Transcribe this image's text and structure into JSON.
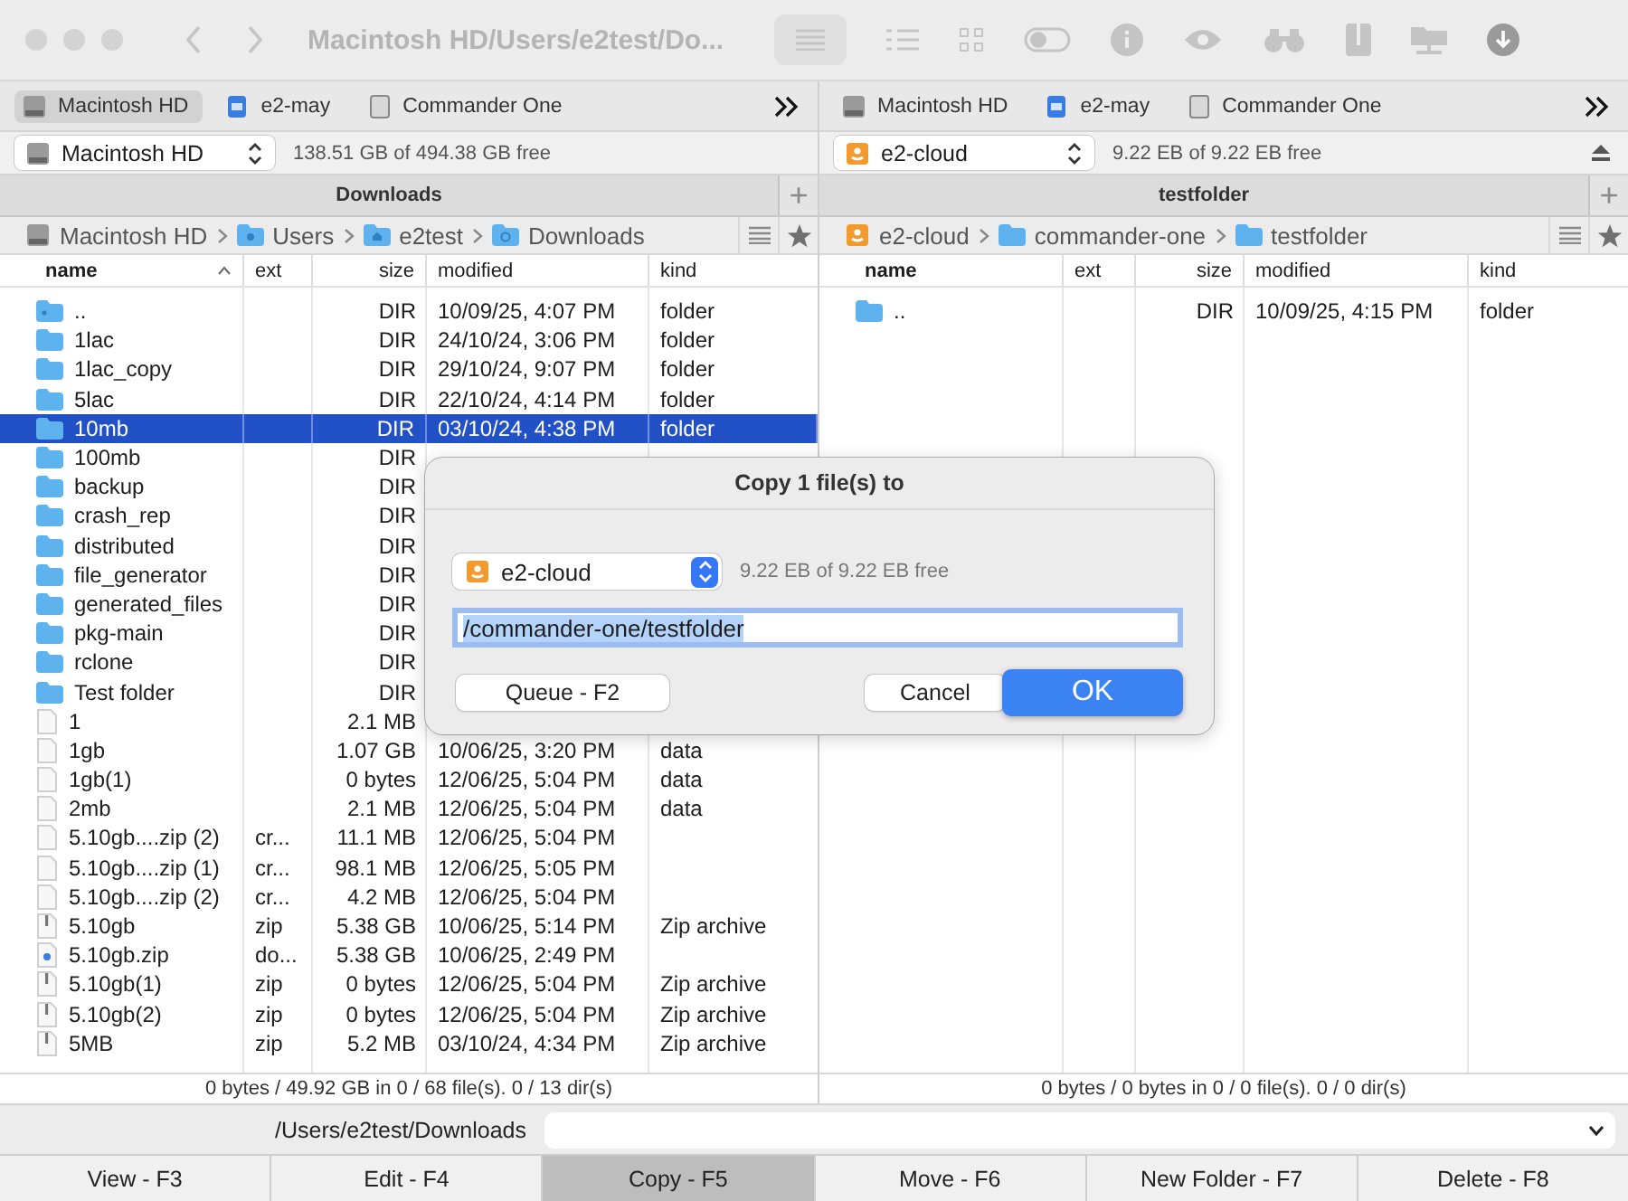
{
  "window": {
    "title": "Macintosh HD/Users/e2test/Do..."
  },
  "panels": [
    {
      "favorites": [
        {
          "label": "Macintosh HD",
          "kind": "disk",
          "selected": true
        },
        {
          "label": "e2-may",
          "kind": "network",
          "selected": false
        },
        {
          "label": "Commander One",
          "kind": "volume",
          "selected": false
        }
      ],
      "drive": {
        "name": "Macintosh HD",
        "kind": "disk",
        "free": "138.51 GB of 494.38 GB free",
        "eject": false
      },
      "title": "Downloads",
      "add_tab": "+",
      "breadcrumb": [
        {
          "label": "Macintosh HD",
          "kind": "disk"
        },
        {
          "label": "Users",
          "kind": "users"
        },
        {
          "label": "e2test",
          "kind": "home"
        },
        {
          "label": "Downloads",
          "kind": "downloads"
        }
      ],
      "columns": [
        "name",
        "ext",
        "size",
        "modified",
        "kind"
      ],
      "rows": [
        {
          "kind": "parent",
          "name": "..",
          "ext": "",
          "size": "DIR",
          "modified": "10/09/25, 4:07 PM",
          "file_kind": "folder",
          "selected": false
        },
        {
          "kind": "folder",
          "name": "1lac",
          "ext": "",
          "size": "DIR",
          "modified": "24/10/24, 3:06 PM",
          "file_kind": "folder",
          "selected": false
        },
        {
          "kind": "folder",
          "name": "1lac_copy",
          "ext": "",
          "size": "DIR",
          "modified": "29/10/24, 9:07 PM",
          "file_kind": "folder",
          "selected": false
        },
        {
          "kind": "folder",
          "name": "5lac",
          "ext": "",
          "size": "DIR",
          "modified": "22/10/24, 4:14 PM",
          "file_kind": "folder",
          "selected": false
        },
        {
          "kind": "folder",
          "name": "10mb",
          "ext": "",
          "size": "DIR",
          "modified": "03/10/24, 4:38 PM",
          "file_kind": "folder",
          "selected": true
        },
        {
          "kind": "folder",
          "name": "100mb",
          "ext": "",
          "size": "DIR",
          "selected": false
        },
        {
          "kind": "folder",
          "name": "backup",
          "ext": "",
          "size": "DIR",
          "selected": false
        },
        {
          "kind": "folder",
          "name": "crash_rep",
          "ext": "",
          "size": "DIR",
          "selected": false
        },
        {
          "kind": "folder",
          "name": "distributed",
          "ext": "",
          "size": "DIR",
          "selected": false
        },
        {
          "kind": "folder",
          "name": "file_generator",
          "ext": "",
          "size": "DIR",
          "selected": false
        },
        {
          "kind": "folder",
          "name": "generated_files",
          "ext": "",
          "size": "DIR",
          "selected": false
        },
        {
          "kind": "folder",
          "name": "pkg-main",
          "ext": "",
          "size": "DIR",
          "selected": false
        },
        {
          "kind": "folder",
          "name": "rclone",
          "ext": "",
          "size": "DIR",
          "selected": false
        },
        {
          "kind": "folder",
          "name": "Test folder",
          "ext": "",
          "size": "DIR",
          "selected": false
        },
        {
          "kind": "file",
          "name": "1",
          "ext": "",
          "size": "2.1 MB",
          "selected": false
        },
        {
          "kind": "file",
          "name": "1gb",
          "ext": "",
          "size": "1.07 GB",
          "modified": "10/06/25, 3:20 PM",
          "file_kind": "data",
          "selected": false
        },
        {
          "kind": "file",
          "name": "1gb(1)",
          "ext": "",
          "size": "0 bytes",
          "modified": "12/06/25, 5:04 PM",
          "file_kind": "data",
          "selected": false
        },
        {
          "kind": "file",
          "name": "2mb",
          "ext": "",
          "size": "2.1 MB",
          "modified": "12/06/25, 5:04 PM",
          "file_kind": "data",
          "selected": false
        },
        {
          "kind": "file",
          "name": "5.10gb....zip (2)",
          "ext": "cr...",
          "size": "11.1 MB",
          "modified": "12/06/25, 5:04 PM",
          "selected": false
        },
        {
          "kind": "file",
          "name": "5.10gb....zip (1)",
          "ext": "cr...",
          "size": "98.1 MB",
          "modified": "12/06/25, 5:05 PM",
          "selected": false
        },
        {
          "kind": "file",
          "name": "5.10gb....zip (2)",
          "ext": "cr...",
          "size": "4.2 MB",
          "modified": "12/06/25, 5:04 PM",
          "selected": false
        },
        {
          "kind": "zip",
          "name": "5.10gb",
          "ext": "zip",
          "size": "5.38 GB",
          "modified": "10/06/25, 5:14 PM",
          "file_kind": "Zip archive",
          "selected": false
        },
        {
          "kind": "download",
          "name": "5.10gb.zip",
          "ext": "do...",
          "size": "5.38 GB",
          "modified": "10/06/25, 2:49 PM",
          "selected": false
        },
        {
          "kind": "zip",
          "name": "5.10gb(1)",
          "ext": "zip",
          "size": "0 bytes",
          "modified": "12/06/25, 5:04 PM",
          "file_kind": "Zip archive",
          "selected": false
        },
        {
          "kind": "zip",
          "name": "5.10gb(2)",
          "ext": "zip",
          "size": "0 bytes",
          "modified": "12/06/25, 5:04 PM",
          "file_kind": "Zip archive",
          "selected": false
        },
        {
          "kind": "zip",
          "name": "5MB",
          "ext": "zip",
          "size": "5.2 MB",
          "modified": "03/10/24, 4:34 PM",
          "file_kind": "Zip archive",
          "selected": false
        }
      ],
      "status": "0 bytes / 49.92 GB in 0 / 68 file(s). 0 / 13 dir(s)"
    },
    {
      "favorites": [
        {
          "label": "Macintosh HD",
          "kind": "disk",
          "selected": false
        },
        {
          "label": "e2-may",
          "kind": "network",
          "selected": false
        },
        {
          "label": "Commander One",
          "kind": "volume",
          "selected": false
        }
      ],
      "drive": {
        "name": "e2-cloud",
        "kind": "cloud",
        "free": "9.22 EB of 9.22 EB free",
        "eject": true
      },
      "title": "testfolder",
      "add_tab": "+",
      "breadcrumb": [
        {
          "label": "e2-cloud",
          "kind": "cloud"
        },
        {
          "label": "commander-one",
          "kind": "folder"
        },
        {
          "label": "testfolder",
          "kind": "folder"
        }
      ],
      "columns": [
        "name",
        "ext",
        "size",
        "modified",
        "kind"
      ],
      "rows": [
        {
          "kind": "folder",
          "name": "..",
          "ext": "",
          "size": "DIR",
          "modified": "10/09/25, 4:15 PM",
          "file_kind": "folder",
          "selected": false
        }
      ],
      "status": "0 bytes / 0 bytes in 0 / 0 file(s). 0 / 0 dir(s)"
    }
  ],
  "command_line": {
    "path": "/Users/e2test/Downloads"
  },
  "function_keys": [
    {
      "label": "View - F3",
      "selected": false
    },
    {
      "label": "Edit - F4",
      "selected": false
    },
    {
      "label": "Copy - F5",
      "selected": true
    },
    {
      "label": "Move - F6",
      "selected": false
    },
    {
      "label": "New Folder - F7",
      "selected": false
    },
    {
      "label": "Delete - F8",
      "selected": false
    }
  ],
  "dialog": {
    "title": "Copy 1 file(s) to",
    "drive": {
      "name": "e2-cloud",
      "kind": "cloud"
    },
    "free": "9.22 EB of 9.22 EB free",
    "path": "/commander-one/testfolder",
    "path_selected": true,
    "buttons": [
      {
        "label": "Queue - F2",
        "kind": "secondary"
      },
      {
        "label": "Cancel",
        "kind": "cancel"
      },
      {
        "label": "OK",
        "kind": "default"
      }
    ]
  }
}
